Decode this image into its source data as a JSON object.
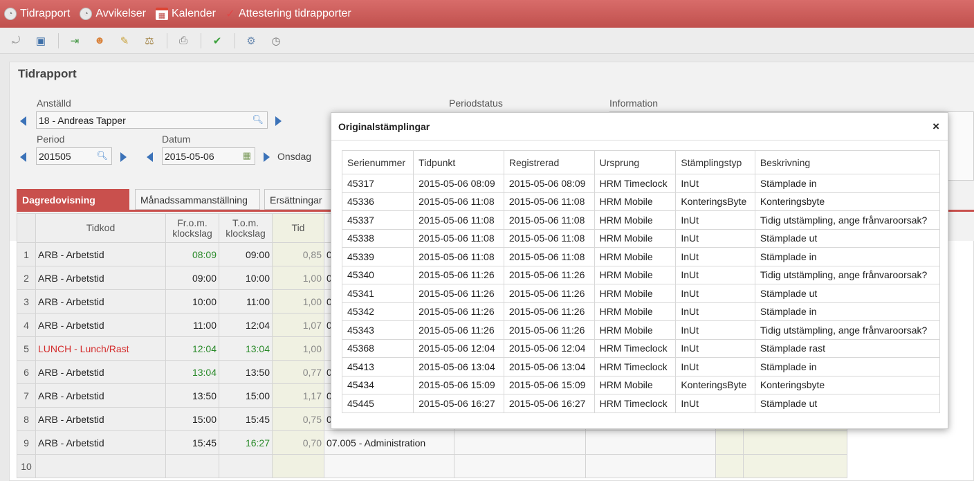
{
  "topnav": {
    "items": [
      {
        "label": "Tidrapport",
        "icon": "clock-icon"
      },
      {
        "label": "Avvikelser",
        "icon": "clock-icon"
      },
      {
        "label": "Kalender",
        "icon": "calendar-icon"
      },
      {
        "label": "Attestering tidrapporter",
        "icon": "checkmark-icon"
      }
    ]
  },
  "toolbar": {
    "icons": [
      "undo-icon",
      "save-icon",
      "export-icon",
      "user-icon",
      "edit-icon",
      "balance-icon",
      "print-icon",
      "approve-icon",
      "settings-icon",
      "clock-icon"
    ]
  },
  "page": {
    "title": "Tidrapport",
    "employee_label": "Anställd",
    "employee_value": "18 - Andreas Tapper",
    "period_label": "Period",
    "period_value": "201505",
    "date_label": "Datum",
    "date_value": "2015-05-06",
    "weekday": "Onsdag",
    "periodstatus_label": "Periodstatus",
    "information_label": "Information"
  },
  "tabs": [
    "Dagredovisning",
    "Månadssammanställning",
    "Ersättningar"
  ],
  "grid": {
    "headers": {
      "code": "Tidkod",
      "from": "Fr.o.m. klockslag",
      "to": "T.o.m. klockslag",
      "tid": "Tid"
    },
    "rows": [
      {
        "n": "1",
        "code": "ARB - Arbetstid",
        "from": "08:09",
        "to": "09:00",
        "tid": "0,85",
        "proj": "0"
      },
      {
        "n": "2",
        "code": "ARB - Arbetstid",
        "from": "09:00",
        "to": "10:00",
        "tid": "1,00",
        "proj": "0"
      },
      {
        "n": "3",
        "code": "ARB - Arbetstid",
        "from": "10:00",
        "to": "11:00",
        "tid": "1,00",
        "proj": "0"
      },
      {
        "n": "4",
        "code": "ARB - Arbetstid",
        "from": "11:00",
        "to": "12:04",
        "tid": "1,07",
        "proj": "0"
      },
      {
        "n": "5",
        "code": "LUNCH - Lunch/Rast",
        "from": "12:04",
        "to": "13:04",
        "tid": "1,00",
        "proj": ""
      },
      {
        "n": "6",
        "code": "ARB - Arbetstid",
        "from": "13:04",
        "to": "13:50",
        "tid": "0,77",
        "proj": "0"
      },
      {
        "n": "7",
        "code": "ARB - Arbetstid",
        "from": "13:50",
        "to": "15:00",
        "tid": "1,17",
        "proj": "0"
      },
      {
        "n": "8",
        "code": "ARB - Arbetstid",
        "from": "15:00",
        "to": "15:45",
        "tid": "0,75",
        "proj": "0"
      },
      {
        "n": "9",
        "code": "ARB - Arbetstid",
        "from": "15:45",
        "to": "16:27",
        "tid": "0,70",
        "proj": "07.005 - Administration"
      },
      {
        "n": "10",
        "code": "",
        "from": "",
        "to": "",
        "tid": "",
        "proj": ""
      }
    ]
  },
  "modal": {
    "title": "Originalstämplingar",
    "close": "×",
    "columns": [
      "Serienummer",
      "Tidpunkt",
      "Registrerad",
      "Ursprung",
      "Stämplingstyp",
      "Beskrivning"
    ],
    "rows": [
      [
        "45317",
        "2015-05-06 08:09",
        "2015-05-06 08:09",
        "HRM Timeclock",
        "InUt",
        "Stämplade in"
      ],
      [
        "45336",
        "2015-05-06 11:08",
        "2015-05-06 11:08",
        "HRM Mobile",
        "KonteringsByte",
        "Konteringsbyte"
      ],
      [
        "45337",
        "2015-05-06 11:08",
        "2015-05-06 11:08",
        "HRM Mobile",
        "InUt",
        "Tidig utstämpling, ange frånvaroorsak?"
      ],
      [
        "45338",
        "2015-05-06 11:08",
        "2015-05-06 11:08",
        "HRM Mobile",
        "InUt",
        "Stämplade ut"
      ],
      [
        "45339",
        "2015-05-06 11:08",
        "2015-05-06 11:08",
        "HRM Mobile",
        "InUt",
        "Stämplade in"
      ],
      [
        "45340",
        "2015-05-06 11:26",
        "2015-05-06 11:26",
        "HRM Mobile",
        "InUt",
        "Tidig utstämpling, ange frånvaroorsak?"
      ],
      [
        "45341",
        "2015-05-06 11:26",
        "2015-05-06 11:26",
        "HRM Mobile",
        "InUt",
        "Stämplade ut"
      ],
      [
        "45342",
        "2015-05-06 11:26",
        "2015-05-06 11:26",
        "HRM Mobile",
        "InUt",
        "Stämplade in"
      ],
      [
        "45343",
        "2015-05-06 11:26",
        "2015-05-06 11:26",
        "HRM Mobile",
        "InUt",
        "Tidig utstämpling, ange frånvaroorsak?"
      ],
      [
        "45368",
        "2015-05-06 12:04",
        "2015-05-06 12:04",
        "HRM Timeclock",
        "InUt",
        "Stämplade rast"
      ],
      [
        "45413",
        "2015-05-06 13:04",
        "2015-05-06 13:04",
        "HRM Timeclock",
        "InUt",
        "Stämplade in"
      ],
      [
        "45434",
        "2015-05-06 15:09",
        "2015-05-06 15:09",
        "HRM Mobile",
        "KonteringsByte",
        "Konteringsbyte"
      ],
      [
        "45445",
        "2015-05-06 16:27",
        "2015-05-06 16:27",
        "HRM Timeclock",
        "InUt",
        "Stämplade ut"
      ]
    ]
  },
  "colors": {
    "accent": "#c9504d",
    "link_arrow": "#3b72b8",
    "green_time": "#2a8a2a",
    "red_code": "#d42b2b"
  }
}
